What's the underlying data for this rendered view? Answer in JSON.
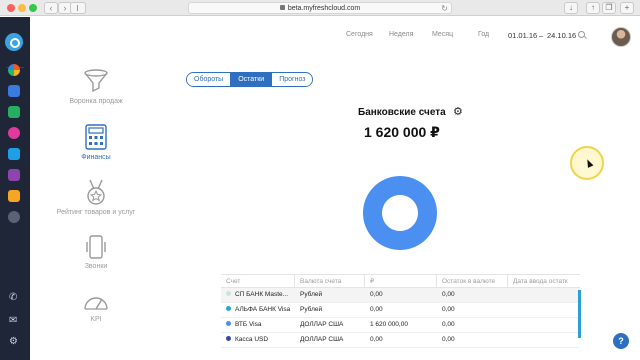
{
  "browser": {
    "url": "beta.myfreshcloud.com"
  },
  "period": {
    "today": "Сегодня",
    "week": "Неделя",
    "month": "Месяц",
    "year": "Год",
    "date_from": "01.01.16",
    "dash": "–",
    "date_to": "24.10.16"
  },
  "sections": [
    {
      "label": "Воронка продаж",
      "icon": "funnel-icon"
    },
    {
      "label": "Финансы",
      "icon": "calculator-icon"
    },
    {
      "label": "Рейтинг товаров и услуг",
      "icon": "medal-icon"
    },
    {
      "label": "Звонки",
      "icon": "phone-icon"
    },
    {
      "label": "KPI",
      "icon": "speedometer-icon"
    }
  ],
  "tabs": [
    "Обороты",
    "Остатки",
    "Прогноз"
  ],
  "active_tab": "Остатки",
  "balance": {
    "title": "Банковские счета",
    "total": "1 620 000 ₽"
  },
  "table": {
    "headers": [
      "Счет",
      "Валюта счета",
      "₽",
      "Остаток в валюте",
      "Дата ввода остатк"
    ],
    "rows": [
      {
        "account": "СП БАНК Maste...",
        "currency": "Рублей",
        "rub": "0,00",
        "balance_cur": "0,00",
        "date": "",
        "color": "#c9e6dc"
      },
      {
        "account": "АЛЬФА БАНК Visa",
        "currency": "Рублей",
        "rub": "0,00",
        "balance_cur": "0,00",
        "date": "",
        "color": "#2aa5d6"
      },
      {
        "account": "ВТБ Visa",
        "currency": "ДОЛЛАР США",
        "rub": "1 620 000,00",
        "balance_cur": "0,00",
        "date": "",
        "color": "#4b8ff0"
      },
      {
        "account": "Касса USD",
        "currency": "ДОЛЛАР США",
        "rub": "0,00",
        "balance_cur": "0,00",
        "date": "",
        "color": "#3a46a8"
      }
    ]
  },
  "chart_data": {
    "type": "pie",
    "categories": [
      "СП БАНК Maste...",
      "АЛЬФА БАНК Visa",
      "ВТБ Visa",
      "Касса USD"
    ],
    "values": [
      0,
      0,
      1620000,
      0
    ],
    "colors": [
      "#c9e6dc",
      "#2aa5d6",
      "#4b8ff0",
      "#3a46a8"
    ]
  },
  "colors": {
    "accent": "#2f6fbf",
    "rail": "#1f2638",
    "donut": "#4b8ff0"
  },
  "help": "?"
}
